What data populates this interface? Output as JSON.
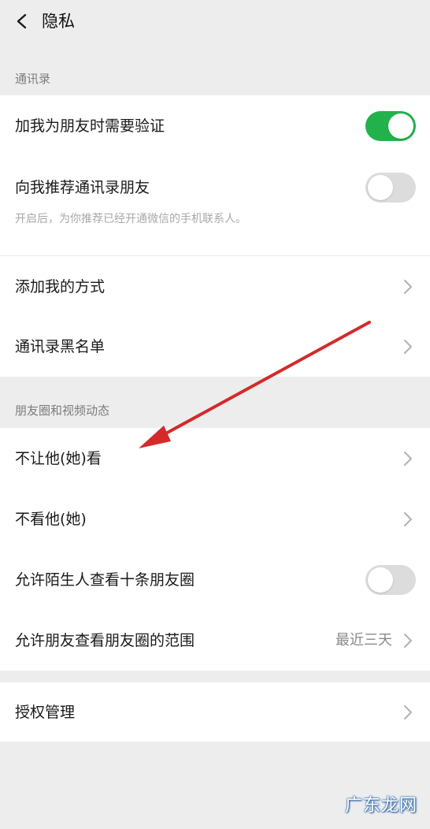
{
  "header": {
    "title": "隐私",
    "back_icon": "chevron-left-icon"
  },
  "contacts_section": {
    "label": "通讯录",
    "items": [
      {
        "label": "加我为朋友时需要验证",
        "toggle": "on"
      },
      {
        "label": "向我推荐通讯录朋友",
        "toggle": "off",
        "description": "开启后，为你推荐已经开通微信的手机联系人。"
      },
      {
        "label": "添加我的方式"
      },
      {
        "label": "通讯录黑名单"
      }
    ]
  },
  "moments_section": {
    "label": "朋友圈和视频动态",
    "items": [
      {
        "label": "不让他(她)看"
      },
      {
        "label": "不看他(她)"
      },
      {
        "label": "允许陌生人查看十条朋友圈",
        "toggle": "off"
      },
      {
        "label": "允许朋友查看朋友圈的范围",
        "value": "最近三天"
      }
    ]
  },
  "auth_section": {
    "items": [
      {
        "label": "授权管理"
      }
    ]
  },
  "annotation": {
    "color": "#d42a2a"
  },
  "colors": {
    "toggle_on": "#22b24c",
    "toggle_off": "#dcdcdc",
    "background": "#ededed"
  },
  "watermark": {
    "text": "广东龙网"
  }
}
